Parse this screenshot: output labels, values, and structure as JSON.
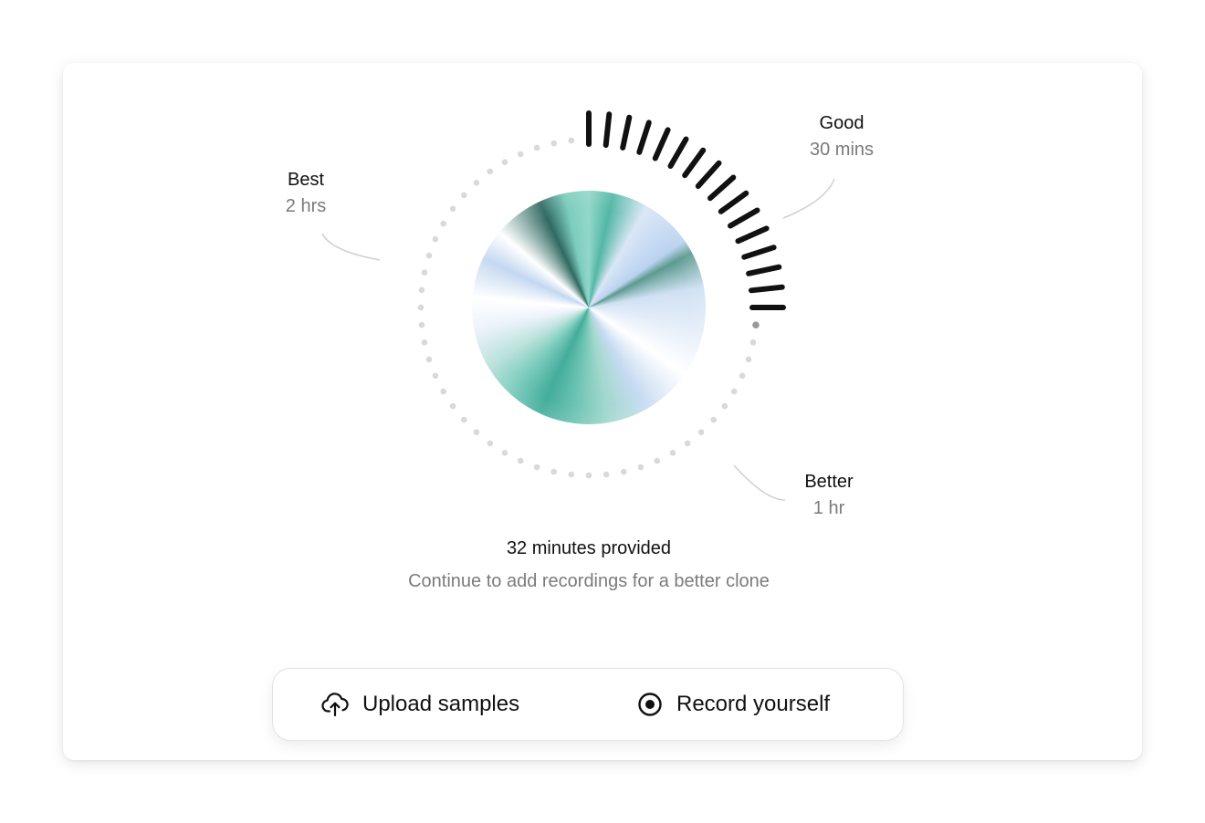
{
  "dial": {
    "progress_minutes": 32,
    "max_minutes": 120,
    "accent_color": "#111111",
    "track_color": "#d9d9d9",
    "milestones": [
      {
        "title": "Good",
        "subtitle": "30 mins"
      },
      {
        "title": "Better",
        "subtitle": "1 hr"
      },
      {
        "title": "Best",
        "subtitle": "2 hrs"
      }
    ]
  },
  "status": {
    "title": "32 minutes provided",
    "subtitle": "Continue to add recordings for a better clone"
  },
  "actions": {
    "upload": {
      "label": "Upload samples",
      "icon": "cloud-upload-icon"
    },
    "record": {
      "label": "Record yourself",
      "icon": "record-icon"
    }
  }
}
